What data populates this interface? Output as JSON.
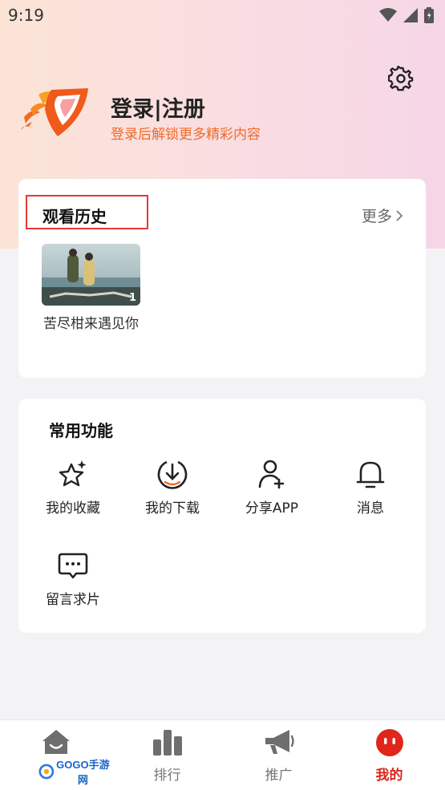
{
  "status_bar": {
    "time": "9:19"
  },
  "profile": {
    "login_title": "登录|注册",
    "login_subtitle": "登录后解锁更多精彩内容"
  },
  "history": {
    "title": "观看历史",
    "more": "更多",
    "items": [
      {
        "title": "苦尽柑来遇见你",
        "episode": "1"
      }
    ]
  },
  "functions": {
    "title": "常用功能",
    "items": [
      {
        "label": "我的收藏",
        "icon": "star-sparkle-icon"
      },
      {
        "label": "我的下载",
        "icon": "download-icon"
      },
      {
        "label": "分享APP",
        "icon": "share-user-icon"
      },
      {
        "label": "消息",
        "icon": "bell-icon"
      },
      {
        "label": "留言求片",
        "icon": "chat-bubble-icon"
      }
    ]
  },
  "tabbar": {
    "tabs": [
      {
        "label": "",
        "icon": "home-icon"
      },
      {
        "label": "排行",
        "icon": "chart-icon"
      },
      {
        "label": "推广",
        "icon": "megaphone-icon"
      },
      {
        "label": "我的",
        "icon": "profile-face-icon",
        "active": true
      }
    ],
    "watermark": "GOGO手游网"
  },
  "colors": {
    "accent": "#f06a2a",
    "active_tab": "#d8261a",
    "highlight_border": "#e53935"
  }
}
